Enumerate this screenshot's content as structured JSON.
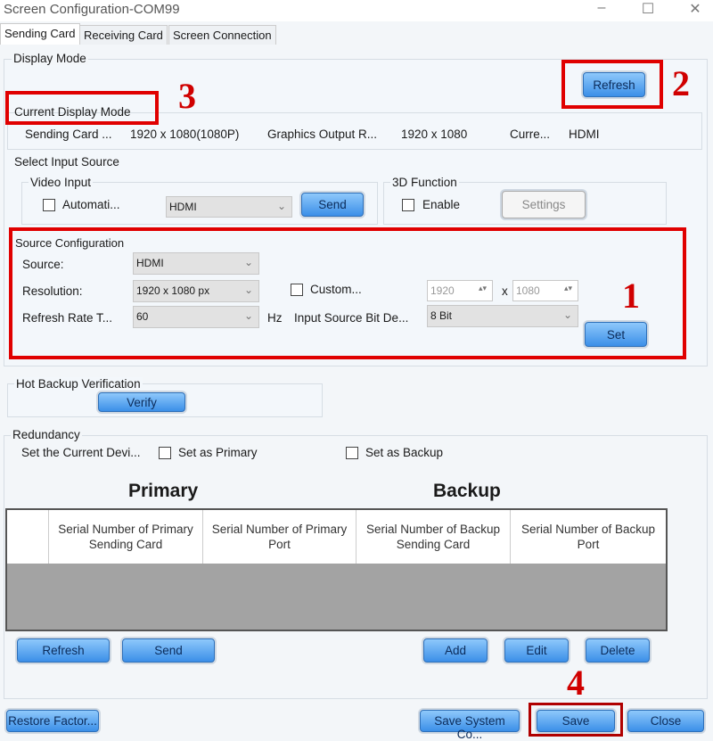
{
  "window": {
    "title": "Screen Configuration-COM99",
    "minimize": "–",
    "maximize": "☐",
    "close": "✕"
  },
  "tabs": [
    {
      "label": "Sending Card",
      "active": true
    },
    {
      "label": "Receiving Card"
    },
    {
      "label": "Screen Connection"
    }
  ],
  "display_mode": {
    "label": "Display Mode",
    "refresh": "Refresh",
    "current_label": "Current Display Mode",
    "fields": [
      "Sending Card ...",
      "1920 x 1080(1080P)",
      "Graphics Output R...",
      "1920 x 1080",
      "Curre...",
      "HDMI"
    ]
  },
  "input_source": {
    "label": "Select Input Source",
    "video_input": "Video Input",
    "auto": "Automati...",
    "video_value": "HDMI",
    "send": "Send",
    "function_3d": "3D Function",
    "enable": "Enable",
    "settings": "Settings"
  },
  "source_config": {
    "label": "Source Configuration",
    "source_label": "Source:",
    "source_value": "HDMI",
    "resolution_label": "Resolution:",
    "resolution_value": "1920 x 1080 px",
    "custom": "Custom...",
    "width": "1920",
    "x": "x",
    "height": "1080",
    "refresh_label": "Refresh Rate T...",
    "refresh_value": "60",
    "hz": "Hz",
    "bit_depth_label": "Input Source Bit De...",
    "bit_depth_value": "8 Bit",
    "set": "Set"
  },
  "hot_backup": {
    "label": "Hot Backup Verification",
    "verify": "Verify"
  },
  "redundancy": {
    "label": "Redundancy",
    "set_current": "Set the Current Devi...",
    "primary_chk": "Set as Primary",
    "backup_chk": "Set as Backup",
    "primary_title": "Primary",
    "backup_title": "Backup",
    "columns": [
      "Serial Number of Primary Sending Card",
      "Serial Number of Primary Port",
      "Serial Number of Backup Sending Card",
      "Serial Number of Backup Port"
    ],
    "refresh": "Refresh",
    "send": "Send",
    "add": "Add",
    "edit": "Edit",
    "delete": "Delete"
  },
  "footer": {
    "restore": "Restore Factor...",
    "save_system": "Save System Co...",
    "save": "Save",
    "close": "Close"
  },
  "annotations": [
    "1",
    "2",
    "3",
    "4"
  ],
  "colors": {
    "annotation": "#e00000",
    "button": "#3b8fe8"
  }
}
